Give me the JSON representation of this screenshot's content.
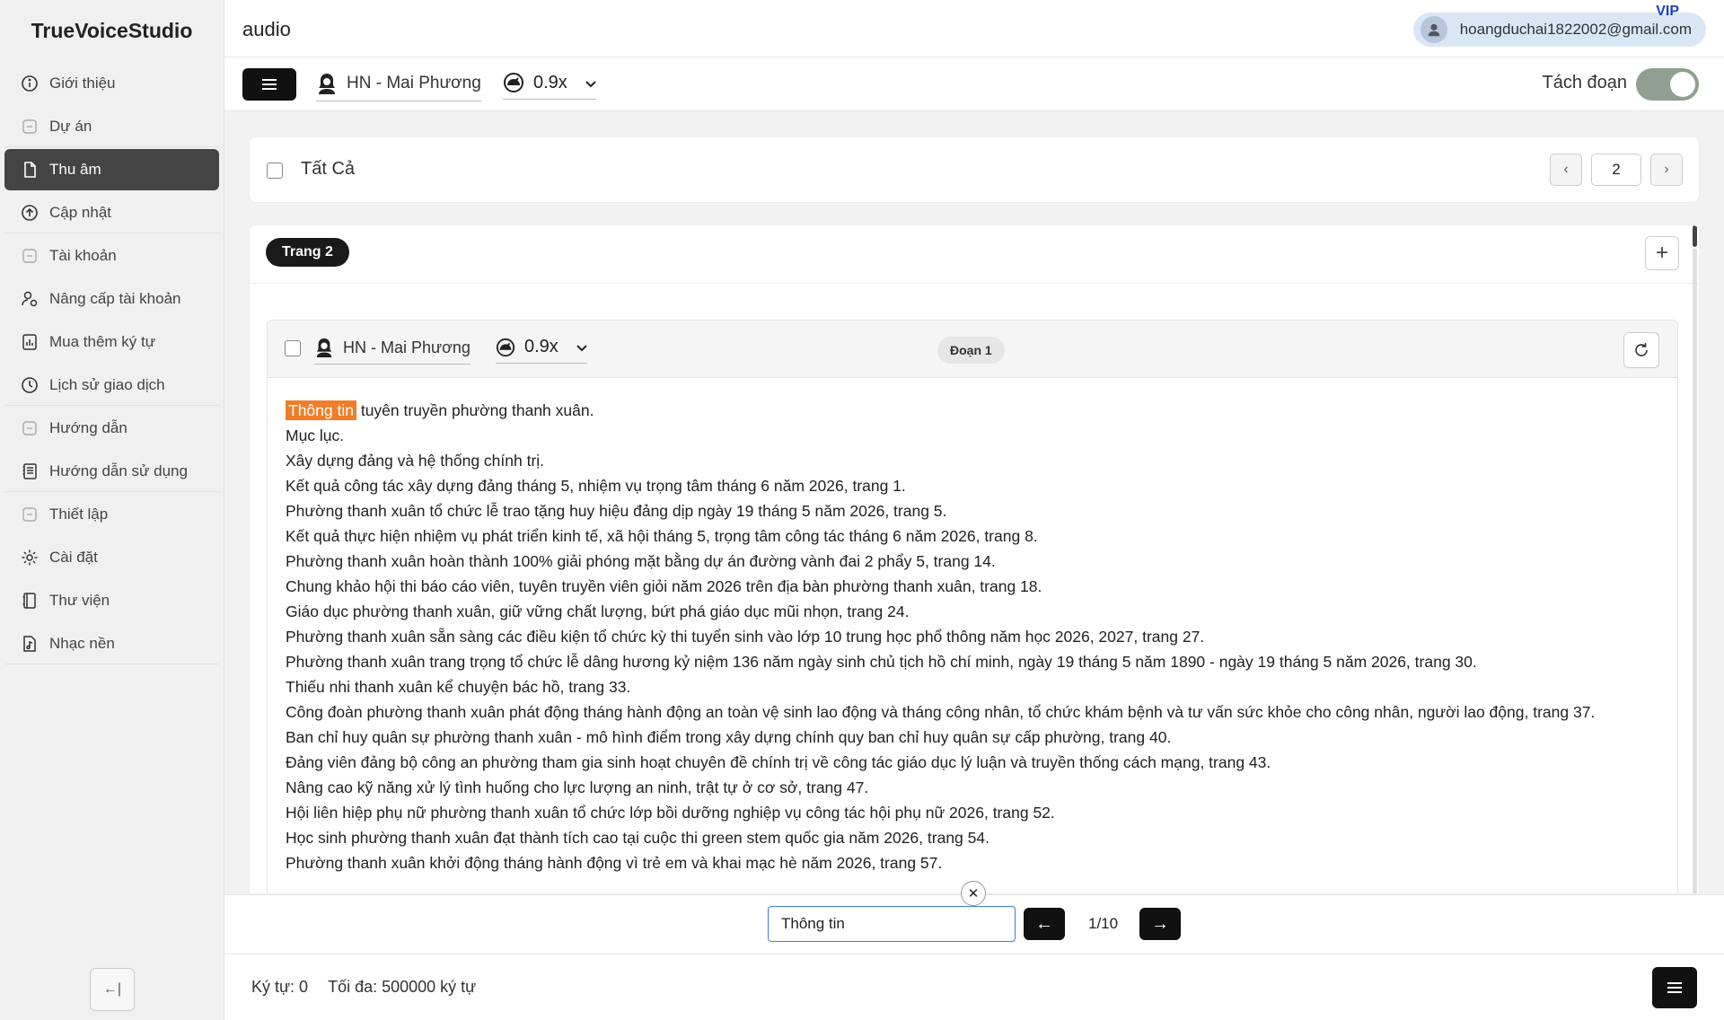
{
  "app": {
    "brand": "TrueVoiceStudio",
    "page_title": "audio"
  },
  "user": {
    "email": "hoangduchai1822002@gmail.com",
    "tier": "VIP"
  },
  "sidebar": {
    "items": [
      {
        "label": "Giới thiệu",
        "icon": "info-icon"
      },
      {
        "label": "Dự án",
        "icon": "square-icon"
      },
      {
        "label": "Thu âm",
        "icon": "file-icon"
      },
      {
        "label": "Cập nhật",
        "icon": "upload-circle-icon"
      },
      {
        "label": "Tài khoản",
        "icon": "square-icon"
      },
      {
        "label": "Nâng cấp tài khoản",
        "icon": "user-upgrade-icon"
      },
      {
        "label": "Mua thêm ký tự",
        "icon": "chart-icon"
      },
      {
        "label": "Lịch sử giao dịch",
        "icon": "clock-icon"
      },
      {
        "label": "Hướng dẫn",
        "icon": "square-icon"
      },
      {
        "label": "Hướng dẫn sử dụng",
        "icon": "document-icon"
      },
      {
        "label": "Thiết lập",
        "icon": "square-icon"
      },
      {
        "label": "Cài đặt",
        "icon": "gear-icon"
      },
      {
        "label": "Thư viện",
        "icon": "book-icon"
      },
      {
        "label": "Nhạc nền",
        "icon": "music-file-icon"
      }
    ],
    "active": "Thu âm",
    "collapse_glyph": "←|"
  },
  "toolbar": {
    "voice": "HN - Mai Phương",
    "speed": "0.9x",
    "split_label": "Tách đoạn",
    "split_enabled": true
  },
  "selection": {
    "all_label": "Tất Cả",
    "page_number": "2"
  },
  "page": {
    "label": "Trang 2",
    "segment": {
      "label": "Đoạn 1",
      "voice": "HN - Mai Phương",
      "speed": "0.9x",
      "highlight": "Thông tin",
      "first_line_rest": " tuyên truyền phường thanh xuân.",
      "lines": [
        "Mục lục.",
        "Xây dựng đảng và hệ thống chính trị.",
        "Kết quả công tác xây dựng đảng tháng 5, nhiệm vụ trọng tâm tháng 6 năm 2026, trang 1.",
        "Phường thanh xuân tổ chức lễ trao tặng huy hiệu đảng dịp ngày 19 tháng 5 năm 2026, trang 5.",
        "Kết quả thực hiện nhiệm vụ phát triển kinh tế, xã hội tháng 5, trọng tâm công tác tháng 6 năm 2026, trang 8.",
        "Phường thanh xuân hoàn thành 100% giải phóng mặt bằng dự án đường vành đai 2 phẩy 5, trang 14.",
        "Chung khảo hội thi báo cáo viên, tuyên truyền viên giỏi năm 2026 trên địa bàn phường thanh xuân, trang 18.",
        "Giáo dục phường thanh xuân, giữ vững chất lượng, bứt phá giáo dục mũi nhọn, trang 24.",
        "Phường thanh xuân sẵn sàng các điều kiện tổ chức kỳ thi tuyển sinh vào lớp 10 trung học phổ thông năm học 2026, 2027, trang 27.",
        "Phường thanh xuân trang trọng tổ chức lễ dâng hương kỷ niệm 136 năm ngày sinh chủ tịch hồ chí minh, ngày 19 tháng 5 năm 1890 - ngày 19 tháng 5 năm 2026, trang 30.",
        "Thiếu nhi thanh xuân kể chuyện bác hồ, trang 33.",
        "Công đoàn phường thanh xuân phát động tháng hành động an toàn vệ sinh lao động và tháng công nhân, tổ chức khám bệnh và tư vấn sức khỏe cho công nhân, người lao động, trang 37.",
        "Ban chỉ huy quân sự phường thanh xuân - mô hình điểm trong xây dựng chính quy ban chỉ huy quân sự cấp phường, trang 40.",
        "Đảng viên đảng bộ công an phường tham gia sinh hoạt chuyên đề chính trị về công tác giáo dục lý luận và truyền thống cách mạng, trang 43.",
        "Nâng cao kỹ năng xử lý tình huống cho lực lượng an ninh, trật tự ở cơ sở, trang 47.",
        "Hội liên hiệp phụ nữ phường thanh xuân tổ chức lớp bồi dưỡng nghiệp vụ công tác hội phụ nữ 2026, trang 52.",
        "Học sinh phường thanh xuân đạt thành tích cao tại cuộc thi green stem quốc gia năm 2026, trang 54.",
        "Phường thanh xuân khởi động tháng hành động vì trẻ em và khai mạc hè năm 2026, trang 57."
      ]
    }
  },
  "search": {
    "value": "Thông tin",
    "match": "1/10"
  },
  "footer": {
    "chars": "Ký tự: 0",
    "max": "Tối đa: 500000 ký tự"
  },
  "colors": {
    "highlight": "#f07d2a",
    "active_nav": "#444444",
    "toggle_on": "#8fa091",
    "vip": "#1a3fc6"
  }
}
